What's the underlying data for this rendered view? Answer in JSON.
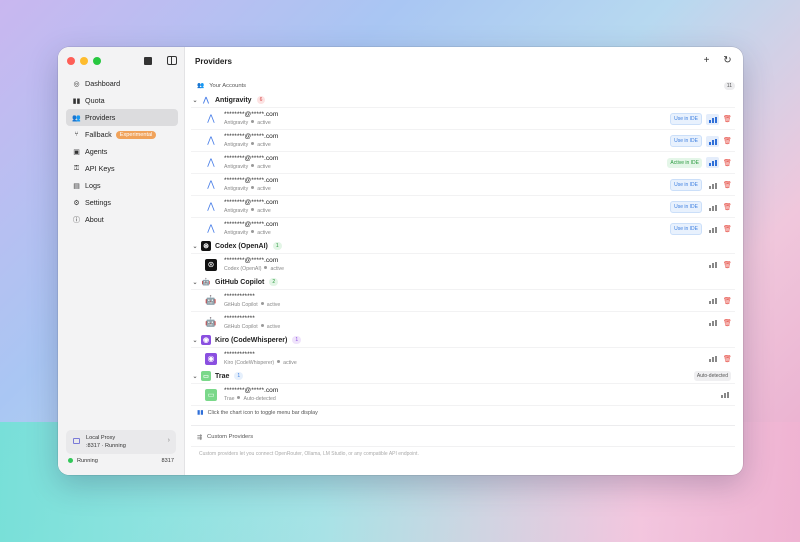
{
  "window_title": "Providers",
  "sidebar": {
    "items": [
      {
        "label": "Dashboard",
        "icon": "dashboard-icon"
      },
      {
        "label": "Quota",
        "icon": "quota-icon"
      },
      {
        "label": "Providers",
        "icon": "providers-icon",
        "active": true
      },
      {
        "label": "Fallback",
        "icon": "fallback-icon",
        "badge": "Experimental"
      },
      {
        "label": "Agents",
        "icon": "agents-icon"
      },
      {
        "label": "API Keys",
        "icon": "key-icon"
      },
      {
        "label": "Logs",
        "icon": "logs-icon"
      },
      {
        "label": "Settings",
        "icon": "settings-icon"
      },
      {
        "label": "About",
        "icon": "about-icon"
      }
    ],
    "proxy": {
      "title": "Local Proxy",
      "status": ":8317 · Running"
    },
    "running": {
      "label": "Running",
      "port": "8317"
    }
  },
  "main": {
    "your_accounts_label": "Your Accounts",
    "your_accounts_count": "11",
    "groups": [
      {
        "name": "Antigravity",
        "count": "6",
        "accounts": [
          {
            "email": "********@*****.com",
            "provider": "Antigravity",
            "status": "active",
            "action": "Use in IDE"
          },
          {
            "email": "********@*****.com",
            "provider": "Antigravity",
            "status": "active",
            "action": "Use in IDE"
          },
          {
            "email": "********@*****.com",
            "provider": "Antigravity",
            "status": "active",
            "action": "Active in IDE"
          },
          {
            "email": "********@*****.com",
            "provider": "Antigravity",
            "status": "active",
            "action": "Use in IDE"
          },
          {
            "email": "********@*****.com",
            "provider": "Antigravity",
            "status": "active",
            "action": "Use in IDE"
          },
          {
            "email": "********@*****.com",
            "provider": "Antigravity",
            "status": "active",
            "action": "Use in IDE"
          }
        ]
      },
      {
        "name": "Codex (OpenAI)",
        "count": "1",
        "accounts": [
          {
            "email": "********@*****.com",
            "provider": "Codex (OpenAI)",
            "status": "active"
          }
        ]
      },
      {
        "name": "GitHub Copilot",
        "count": "2",
        "accounts": [
          {
            "email": "************",
            "provider": "GitHub Copilot",
            "status": "active"
          },
          {
            "email": "************",
            "provider": "GitHub Copilot",
            "status": "active"
          }
        ]
      },
      {
        "name": "Kiro (CodeWhisperer)",
        "count": "1",
        "accounts": [
          {
            "email": "************",
            "provider": "Kiro (CodeWhisperer)",
            "status": "active"
          }
        ]
      },
      {
        "name": "Trae",
        "count": "1",
        "tag": "Auto-detected",
        "accounts": [
          {
            "email": "********@*****.com",
            "provider": "Trae",
            "status": "Auto-detected"
          }
        ]
      }
    ],
    "chart_hint": "Click the chart icon to toggle menu bar display",
    "custom_providers_label": "Custom Providers",
    "custom_providers_desc": "Custom providers let you connect OpenRouter, Ollama, LM Studio, or any compatible API endpoint."
  },
  "colors": {
    "accent": "#2f6fd8",
    "active_green": "#2a9a3f",
    "danger": "#e5483f",
    "badge": "#f0a25a"
  }
}
